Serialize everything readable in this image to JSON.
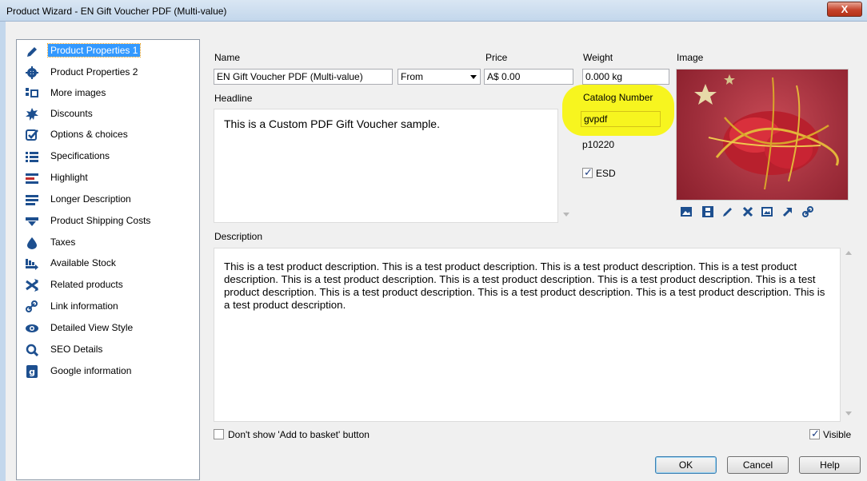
{
  "window": {
    "title": "Product Wizard - EN Gift Voucher PDF (Multi-value)",
    "close_label": "X"
  },
  "sidebar": {
    "items": [
      {
        "label": "Product Properties 1",
        "icon": "pencil-icon",
        "selected": true
      },
      {
        "label": "Product Properties 2",
        "icon": "gear-icon"
      },
      {
        "label": "More images",
        "icon": "images-icon"
      },
      {
        "label": "Discounts",
        "icon": "starburst-icon"
      },
      {
        "label": "Options & choices",
        "icon": "checkbox-icon"
      },
      {
        "label": "Specifications",
        "icon": "list-icon"
      },
      {
        "label": "Highlight",
        "icon": "lines-icon"
      },
      {
        "label": "Longer Description",
        "icon": "paragraph-icon"
      },
      {
        "label": "Product Shipping Costs",
        "icon": "truck-icon"
      },
      {
        "label": "Taxes",
        "icon": "drop-icon"
      },
      {
        "label": "Available Stock",
        "icon": "stock-icon"
      },
      {
        "label": "Related products",
        "icon": "shuffle-icon"
      },
      {
        "label": "Link information",
        "icon": "link-icon"
      },
      {
        "label": "Detailed View Style",
        "icon": "eye-icon"
      },
      {
        "label": "SEO Details",
        "icon": "magnifier-icon"
      },
      {
        "label": "Google information",
        "icon": "google-icon"
      }
    ]
  },
  "form": {
    "name_label": "Name",
    "name_value": "EN Gift Voucher PDF (Multi-value)",
    "price_label": "Price",
    "price_mode": "From",
    "price_value": "A$ 0.00",
    "weight_label": "Weight",
    "weight_value": "0.000 kg",
    "image_label": "Image",
    "headline_label": "Headline",
    "headline_value": "This is a Custom PDF Gift Voucher sample.",
    "catalog_label": "Catalog Number",
    "catalog_value": "gvpdf",
    "product_id": "p10220",
    "esd_label": "ESD",
    "esd_checked": true,
    "description_label": "Description",
    "description_value": "This is a test product description. This is a test product description. This is a test product description. This is a test product description. This is a test product description. This is a test product description. This is a test product description. This is a test product description. This is a test product description. This is a test product description. This is a test product description. This is a test product description.",
    "hide_basket_label": "Don't show 'Add to basket' button",
    "hide_basket_checked": false,
    "visible_label": "Visible",
    "visible_checked": true
  },
  "image_tools": [
    "image-icon",
    "film-icon",
    "pencil-icon",
    "delete-icon",
    "picture-icon",
    "arrow-icon",
    "link-icon"
  ],
  "buttons": {
    "ok": "OK",
    "cancel": "Cancel",
    "help": "Help"
  }
}
